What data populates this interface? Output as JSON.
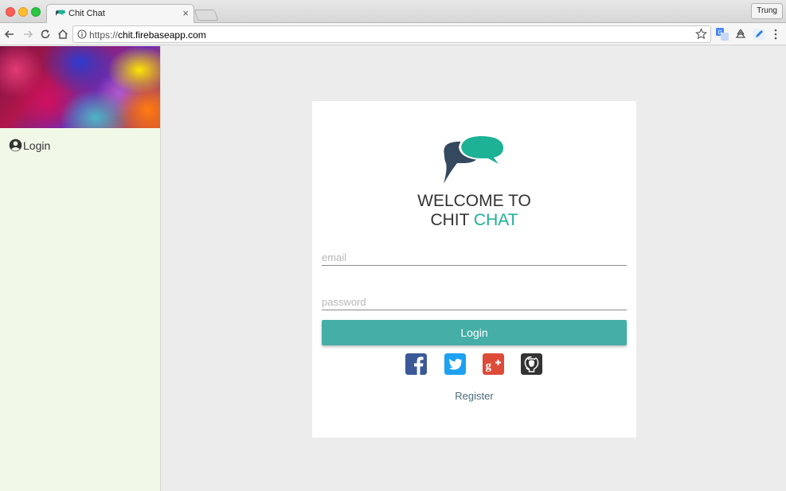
{
  "browser": {
    "tab_title": "Chit Chat",
    "tab_close": "×",
    "user_name": "Trung",
    "url_scheme": "https://",
    "url_host": "chit.firebaseapp.com"
  },
  "sidebar": {
    "login_label": "Login"
  },
  "card": {
    "welcome_line1": "WELCOME TO",
    "welcome_chit": "CHIT ",
    "welcome_chat": "CHAT",
    "email_placeholder": "email",
    "password_placeholder": "password",
    "login_button": "Login",
    "register_link": "Register"
  },
  "colors": {
    "accent": "#1db195",
    "button": "#45aea7",
    "sidebar_bg": "#f1f8e8",
    "facebook": "#3b5998",
    "twitter": "#1da1f2",
    "google_plus": "#dd4b39",
    "github": "#333333"
  },
  "icons": [
    "chat-bubble-logo-icon",
    "account-circle-icon",
    "facebook-icon",
    "twitter-icon",
    "google-plus-icon",
    "github-icon"
  ]
}
